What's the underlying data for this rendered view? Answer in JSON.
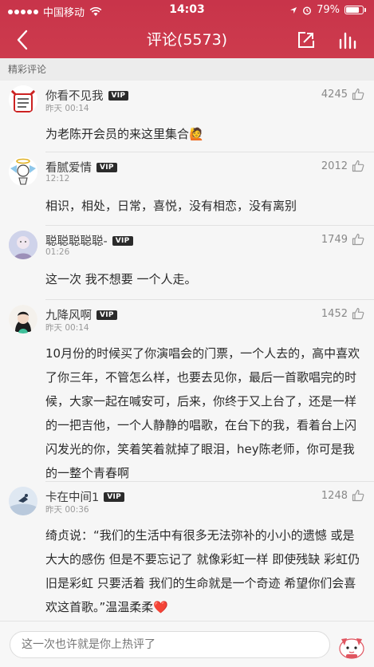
{
  "status": {
    "carrier": "中国移动",
    "time": "14:03",
    "battery": "79%"
  },
  "header": {
    "title": "评论(5573)"
  },
  "section": {
    "label": "精彩评论"
  },
  "comments": [
    {
      "user": "你看不见我",
      "vip": "VIP",
      "time": "昨天 00:14",
      "likes": "4245",
      "text": "为老陈开会员的来这里集合🙋"
    },
    {
      "user": "看腻爱情",
      "vip": "VIP",
      "time": "12:12",
      "likes": "2012",
      "text": "相识，相处，日常，喜悦，没有相恋，没有离别"
    },
    {
      "user": "聪聪聪聪聪-",
      "vip": "VIP",
      "time": "01:26",
      "likes": "1749",
      "text": "这一次  我不想要  一个人走。"
    },
    {
      "user": "九降风啊",
      "vip": "VIP",
      "time": "昨天 00:14",
      "likes": "1452",
      "text": "10月份的时候买了你演唱会的门票，一个人去的，高中喜欢了你三年，不管怎么样，也要去见你，最后一首歌唱完的时候，大家一起在喊安可，后来，你终于又上台了，还是一样的一把吉他，一个人静静的唱歌，在台下的我，看着台上闪闪发光的你，笑着笑着就掉了眼泪，hey陈老师，你可是我的一整个青春啊"
    },
    {
      "user": "卡在中间1",
      "vip": "VIP",
      "time": "昨天 00:36",
      "likes": "1248",
      "text": "绮贞说：“我们的生活中有很多无法弥补的小小的遗憾 或是大大的感伤 但是不要忘记了 就像彩虹一样 即使残缺 彩虹仍旧是彩虹 只要活着 我们的生命就是一个奇迹 希望你们会喜欢这首歌。”温温柔柔❤️"
    }
  ],
  "composer": {
    "placeholder": "这一次也许就是你上热评了"
  },
  "icons": [
    "back-arrow-icon",
    "share-icon",
    "chart-icon",
    "thumb-up-icon",
    "signal-icon",
    "wifi-icon",
    "location-icon",
    "alarm-icon",
    "battery-icon"
  ],
  "colors": {
    "header": "#c8344a",
    "background": "#f6f6f6"
  }
}
